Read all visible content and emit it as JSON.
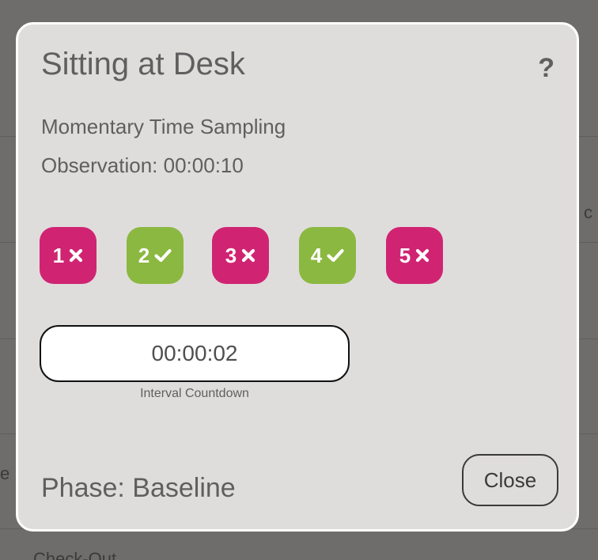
{
  "background": {
    "fragment_right": "c",
    "fragment_left": "e",
    "fragment_bottom": "Check-Out"
  },
  "modal": {
    "title": "Sitting at Desk",
    "help_label": "?",
    "method": "Momentary Time Sampling",
    "observation": "Observation: 00:00:10",
    "intervals": [
      {
        "number": "1",
        "result": "x-mark",
        "color": "#d02473"
      },
      {
        "number": "2",
        "result": "check-mark",
        "color": "#8bb841"
      },
      {
        "number": "3",
        "result": "x-mark",
        "color": "#d02473"
      },
      {
        "number": "4",
        "result": "check-mark",
        "color": "#8bb841"
      },
      {
        "number": "5",
        "result": "x-mark",
        "color": "#d02473"
      }
    ],
    "countdown": {
      "value": "00:00:02",
      "label": "Interval Countdown"
    },
    "phase": "Phase: Baseline",
    "close_label": "Close"
  }
}
